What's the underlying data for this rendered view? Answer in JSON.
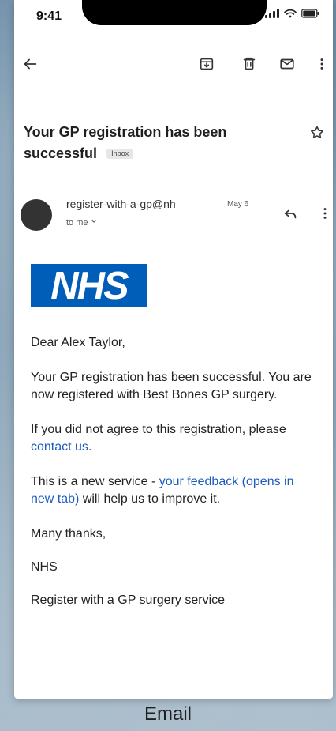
{
  "status_bar": {
    "time": "9:41"
  },
  "toolbar": {
    "back_icon": "arrow-left-icon",
    "archive_icon": "archive-icon",
    "delete_icon": "trash-icon",
    "mail_icon": "mail-icon",
    "more_icon": "more-vertical-icon"
  },
  "email": {
    "subject_line_1": "Your GP registration has been",
    "subject_line_2": "successful",
    "inbox_label": "Inbox",
    "star_icon": "star-icon",
    "sender": "register-with-a-gp@nh",
    "date": "May 6",
    "recipient": "to me",
    "greeting": "Dear Alex Taylor,",
    "body_1": "Your GP registration has been successful. You are now registered with Best Bones GP surgery.",
    "body_2_prefix": "If you did not agree to this registration, please ",
    "body_2_link": "contact us",
    "body_2_suffix": ".",
    "body_3_prefix": "This is a new service - ",
    "body_3_link": "your feedback (opens in new tab)",
    "body_3_suffix": " will help us to improve it.",
    "signoff": "Many thanks,",
    "signature_1": "NHS",
    "signature_2": "Register with a GP surgery service",
    "logo_text": "NHS"
  },
  "caption": {
    "label": "Email"
  },
  "colors": {
    "nhs_blue": "#005eb8",
    "link_blue": "#1d5bbf"
  }
}
